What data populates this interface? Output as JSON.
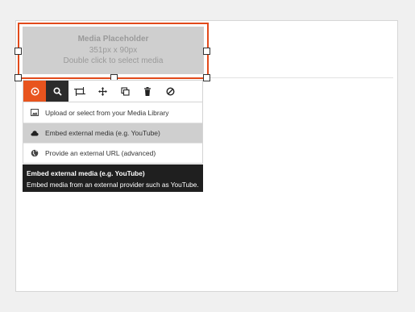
{
  "placeholder": {
    "title": "Media Placeholder",
    "dimensions": "351px x 90px",
    "hint": "Double click to select media"
  },
  "toolbar": {
    "buttons": [
      {
        "icon": "media-source-icon",
        "label": "",
        "state": "active"
      },
      {
        "icon": "search-icon",
        "label": "",
        "state": "pressed"
      },
      {
        "icon": "resize-icon",
        "label": "",
        "state": ""
      },
      {
        "icon": "move-icon",
        "label": "",
        "state": ""
      },
      {
        "icon": "duplicate-icon",
        "label": "",
        "state": ""
      },
      {
        "icon": "trash-icon",
        "label": "",
        "state": ""
      },
      {
        "icon": "disable-icon",
        "label": "",
        "state": ""
      }
    ]
  },
  "menu": {
    "items": [
      {
        "label": "Upload or select from your Media Library",
        "icon": "image-icon"
      },
      {
        "label": "Embed external media (e.g. YouTube)",
        "icon": "cloud-icon",
        "highlighted": true
      },
      {
        "label": "Provide an external URL (advanced)",
        "icon": "globe-icon"
      }
    ]
  },
  "tooltip": {
    "title": "Embed external media (e.g. YouTube)",
    "description": "Embed media from an external provider such as YouTube."
  },
  "colors": {
    "accent": "#e8541e",
    "selection_border": "#e24a1b",
    "tooltip_bg": "#1f1f1f",
    "placeholder_bg": "#cfcfcf"
  }
}
